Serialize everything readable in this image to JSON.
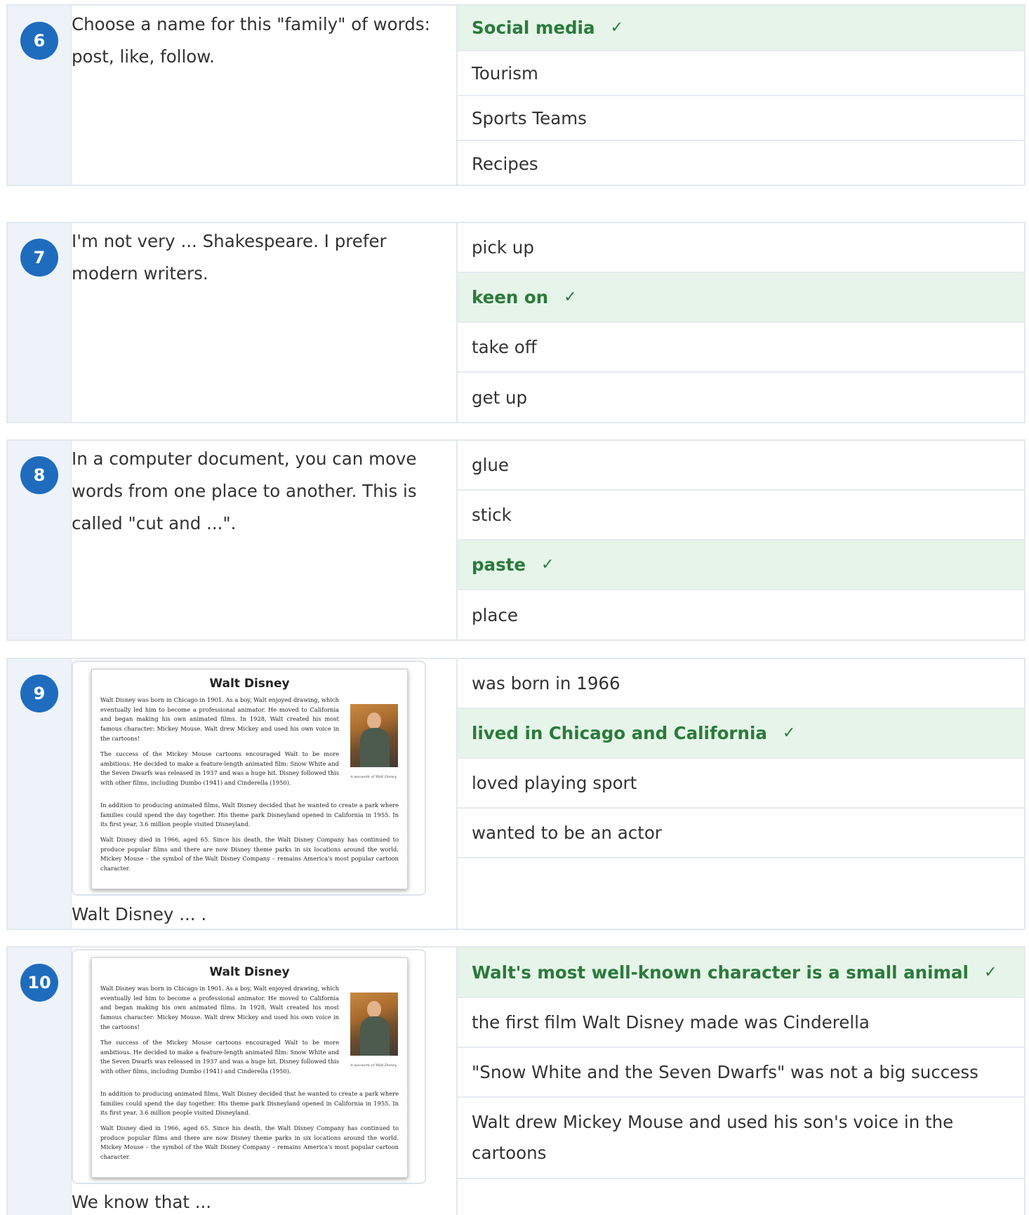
{
  "questions": [
    {
      "number": "6",
      "text": "Choose a name for this \"family\" of words: post, like, follow.",
      "options": [
        {
          "label": "Social media",
          "correct": true
        },
        {
          "label": "Tourism",
          "correct": false
        },
        {
          "label": "Sports Teams",
          "correct": false
        },
        {
          "label": "Recipes",
          "correct": false
        }
      ]
    },
    {
      "number": "7",
      "text": "I'm not very ... Shakespeare. I prefer modern writers.",
      "options": [
        {
          "label": "pick up",
          "correct": false
        },
        {
          "label": "keen on",
          "correct": true
        },
        {
          "label": "take off",
          "correct": false
        },
        {
          "label": "get up",
          "correct": false
        }
      ]
    },
    {
      "number": "8",
      "text": "In a computer document, you can move words from one place to another. This is called \"cut and ...\".",
      "options": [
        {
          "label": "glue",
          "correct": false
        },
        {
          "label": "stick",
          "correct": false
        },
        {
          "label": "paste",
          "correct": true
        },
        {
          "label": "place",
          "correct": false
        }
      ]
    },
    {
      "number": "9",
      "text": "Walt Disney ... .",
      "options": [
        {
          "label": "was born in 1966",
          "correct": false
        },
        {
          "label": "lived in Chicago and California",
          "correct": true
        },
        {
          "label": "loved playing sport",
          "correct": false
        },
        {
          "label": "wanted to be an actor",
          "correct": false
        }
      ]
    },
    {
      "number": "10",
      "text": "We know that ...",
      "options": [
        {
          "label": "Walt's most well-known character is a small animal",
          "correct": true
        },
        {
          "label": "the first film Walt Disney made was Cinderella",
          "correct": false
        },
        {
          "label": "\"Snow White and the Seven Dwarfs\" was not a big success",
          "correct": false
        },
        {
          "label": "Walt drew Mickey Mouse and used his son's voice in the cartoons",
          "correct": false
        }
      ]
    }
  ],
  "check_mark": "✓",
  "reading": {
    "title": "Walt Disney",
    "paragraphs": [
      "Walt Disney was born in Chicago in 1901. As a boy, Walt enjoyed drawing, which eventually led him to become a professional animator. He moved to California and began making his own animated films. In 1928, Walt created his most famous character: Mickey Mouse. Walt drew Mickey and used his own voice in the cartoons!",
      "The success of the Mickey Mouse cartoons encouraged Walt to be more ambitious. He decided to make a feature-length animated film: Snow White and the Seven Dwarfs was released in 1937 and was a huge hit. Disney followed this with other films, including Dumbo (1941) and Cinderella (1950).",
      "In addition to producing animated films, Walt Disney decided that he wanted to create a park where families could spend the day together. His theme park Disneyland opened in California in 1955. In its first year, 3.6 million people visited Disneyland.",
      "Walt Disney died in 1966, aged 65. Since his death, the Walt Disney Company has continued to produce popular films and there are now Disney theme parks in six locations around the world. Mickey Mouse – the symbol of the Walt Disney Company – remains America's most popular cartoon character."
    ],
    "photo_caption": "A waxwork of Walt Disney"
  },
  "colors": {
    "badge": "#1f6cbf",
    "correct_bg": "#e6f4e9",
    "correct_text": "#2b7a3b",
    "number_column_bg": "#eef3fa"
  }
}
